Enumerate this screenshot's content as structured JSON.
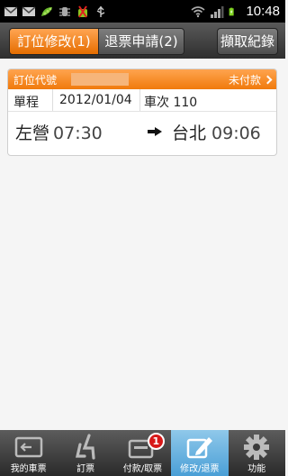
{
  "status_bar": {
    "time": "10:48",
    "icons": [
      "mail-icon",
      "mail-icon",
      "pea-pod-icon",
      "usb-debug-icon",
      "android-blocked-icon",
      "usb-icon",
      "wifi-icon",
      "signal-icon",
      "battery-icon"
    ]
  },
  "tabs": [
    {
      "label": "訂位修改(1)",
      "active": true
    },
    {
      "label": "退票申請(2)",
      "active": false
    }
  ],
  "fetch_button": {
    "label": "擷取紀錄"
  },
  "booking": {
    "code_label": "訂位代號",
    "status": "未付款",
    "trip_type": "單程",
    "date": "2012/01/04",
    "train": "車次 110",
    "from_station": "左營",
    "from_time": "07:30",
    "to_station": "台北",
    "to_time": "09:06"
  },
  "bottom_nav": [
    {
      "label": "我的車票",
      "icon": "my-ticket-icon",
      "active": false
    },
    {
      "label": "訂票",
      "icon": "seat-icon",
      "active": false
    },
    {
      "label": "付款/取票",
      "icon": "payment-icon",
      "active": false,
      "badge": "1"
    },
    {
      "label": "修改/退票",
      "icon": "edit-icon",
      "active": true
    },
    {
      "label": "功能",
      "icon": "gear-icon",
      "active": false
    }
  ],
  "colors": {
    "accent_orange": "#f07a0c",
    "active_blue": "#4a9fd6",
    "badge_red": "#d71919"
  }
}
